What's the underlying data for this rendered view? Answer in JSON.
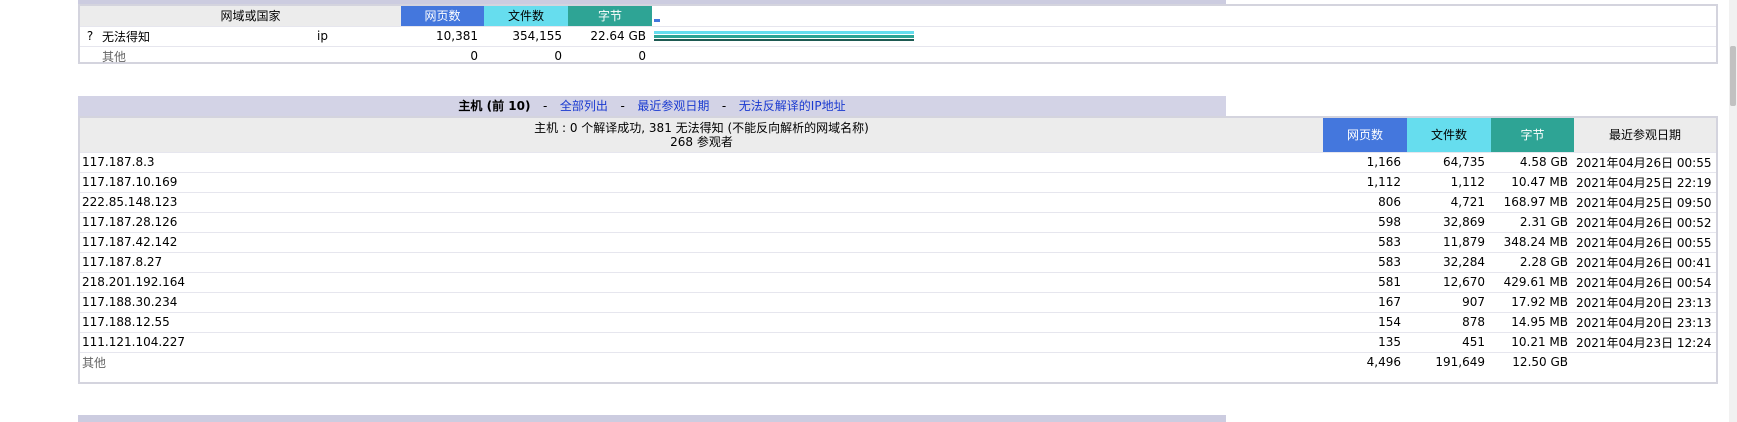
{
  "domains": {
    "headers": {
      "domain": "网域或国家",
      "pages": "网页数",
      "files": "文件数",
      "bytes": "字节"
    },
    "rows": [
      {
        "flag": "?",
        "name": "无法得知",
        "code": "ip",
        "pages": "10,381",
        "files": "354,155",
        "bytes": "22.64 GB"
      },
      {
        "flag": "",
        "name": "其他",
        "code": "",
        "pages": "0",
        "files": "0",
        "bytes": "0"
      }
    ]
  },
  "hosts": {
    "title": "主机 (前 10)",
    "links": {
      "all": "全部列出",
      "last_visit": "最近参观日期",
      "unresolved": "无法反解译的IP地址"
    },
    "sep": "-",
    "summary_line1": "主机 : 0 个解译成功, 381 无法得知 (不能反向解析的网域名称)",
    "summary_line2": "268 参观者",
    "headers": {
      "pages": "网页数",
      "files": "文件数",
      "bytes": "字节",
      "date": "最近参观日期"
    },
    "rows": [
      {
        "host": "117.187.8.3",
        "pages": "1,166",
        "files": "64,735",
        "bytes": "4.58 GB",
        "date": "2021年04月26日 00:55"
      },
      {
        "host": "117.187.10.169",
        "pages": "1,112",
        "files": "1,112",
        "bytes": "10.47 MB",
        "date": "2021年04月25日 22:19"
      },
      {
        "host": "222.85.148.123",
        "pages": "806",
        "files": "4,721",
        "bytes": "168.97 MB",
        "date": "2021年04月25日 09:50"
      },
      {
        "host": "117.187.28.126",
        "pages": "598",
        "files": "32,869",
        "bytes": "2.31 GB",
        "date": "2021年04月26日 00:52"
      },
      {
        "host": "117.187.42.142",
        "pages": "583",
        "files": "11,879",
        "bytes": "348.24 MB",
        "date": "2021年04月26日 00:55"
      },
      {
        "host": "117.187.8.27",
        "pages": "583",
        "files": "32,284",
        "bytes": "2.28 GB",
        "date": "2021年04月26日 00:41"
      },
      {
        "host": "218.201.192.164",
        "pages": "581",
        "files": "12,670",
        "bytes": "429.61 MB",
        "date": "2021年04月26日 00:54"
      },
      {
        "host": "117.188.30.234",
        "pages": "167",
        "files": "907",
        "bytes": "17.92 MB",
        "date": "2021年04月20日 23:13"
      },
      {
        "host": "117.188.12.55",
        "pages": "154",
        "files": "878",
        "bytes": "14.95 MB",
        "date": "2021年04月20日 23:13"
      },
      {
        "host": "111.121.104.227",
        "pages": "135",
        "files": "451",
        "bytes": "10.21 MB",
        "date": "2021年04月23日 12:24"
      }
    ],
    "other": {
      "host": "其他",
      "pages": "4,496",
      "files": "191,649",
      "bytes": "12.50 GB",
      "date": ""
    }
  },
  "colors": {
    "pages": "#4477dd",
    "files": "#66ddee",
    "bytes": "#2ea495",
    "title_bar": "#d3d3e6"
  }
}
